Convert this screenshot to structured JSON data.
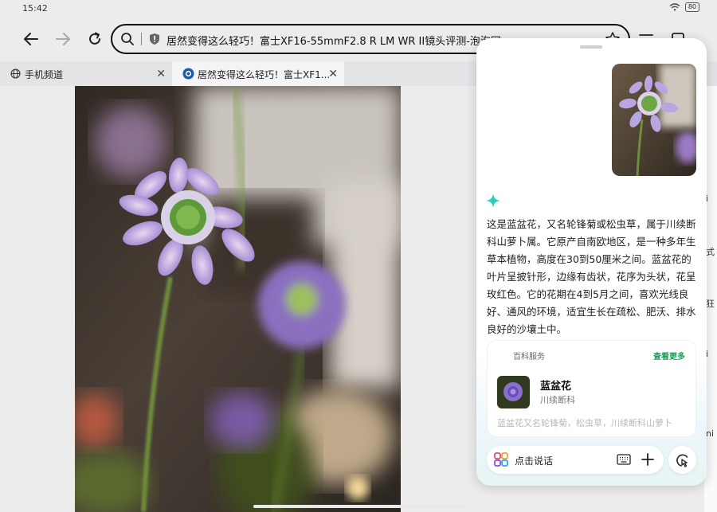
{
  "status": {
    "time": "15:42",
    "battery": "80"
  },
  "browser": {
    "url_title": "居然变得这么轻巧！富士XF16-55mmF2.8 R LM WR II镜头评测-泡泡网",
    "tabs": [
      {
        "label": "手机频道"
      },
      {
        "label": "居然变得这么轻巧！富士XF1..."
      }
    ]
  },
  "page_edge_text": [
    "i",
    "式",
    "狂",
    "i",
    "ni"
  ],
  "assistant": {
    "answer": "这是蓝盆花，又名轮锋菊或松虫草，属于川续断科山萝卜属。它原产自南欧地区，是一种多年生草本植物，高度在30到50厘米之间。蓝盆花的叶片呈披针形，边缘有齿状，花序为头状，花呈玫红色。它的花期在4到5月之间，喜欢光线良好、通风的环境，适宜生长在疏松、肥沃、排水良好的沙壤土中。",
    "card": {
      "service": "百科服务",
      "more": "查看更多",
      "name": "蓝盆花",
      "family": "川续断科",
      "desc": "蓝盆花又名轮锋菊，松虫草，川续断科山萝卜"
    },
    "input_prompt": "点击说话"
  },
  "colors": {
    "accent_green": "#1a9e55",
    "url_border": "#111111",
    "panel_bg": "#ffffff"
  }
}
